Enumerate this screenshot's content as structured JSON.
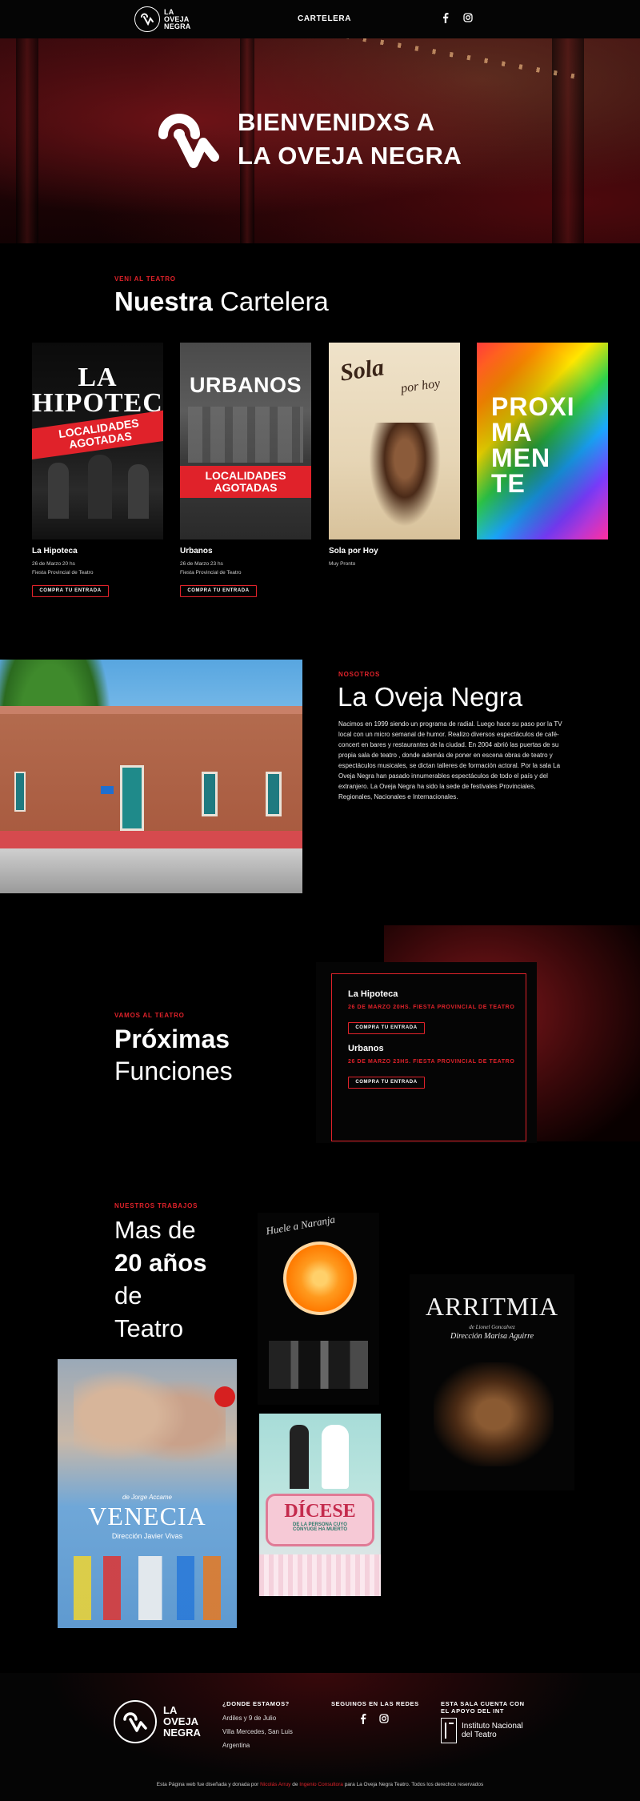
{
  "header": {
    "brand_line1": "LA",
    "brand_line2": "OVEJA",
    "brand_line3": "NEGRA",
    "nav_item": "CARTELERA",
    "social_icons": [
      "facebook-icon",
      "instagram-icon"
    ]
  },
  "hero": {
    "title_line1": "BIENVENIDXS A",
    "title_line2": "LA OVEJA NEGRA"
  },
  "cartelera": {
    "eyebrow": "VENI AL TEATRO",
    "title_bold": "Nuestra",
    "title_light": "Cartelera",
    "cards": [
      {
        "poster_title_line1": "LA",
        "poster_title_line2": "HIPOTECA",
        "badge_line1": "LOCALIDADES",
        "badge_line2": "AGOTADAS",
        "name": "La Hipoteca",
        "date": "26 de Marzo 20 hs",
        "venue": "Fiesta Provincial de Teatro",
        "button": "COMPRA TU ENTRADA"
      },
      {
        "poster_title": "URBANOS",
        "badge_line1": "LOCALIDADES",
        "badge_line2": "AGOTADAS",
        "name": "Urbanos",
        "date": "26 de Marzo 23 hs",
        "venue": "Fiesta Provincial de Teatro",
        "button": "COMPRA TU ENTRADA"
      },
      {
        "poster_title_line1": "Sola",
        "poster_title_line2": "por hoy",
        "name": "Sola por Hoy",
        "info": "Muy Pronto"
      },
      {
        "poster_lines": [
          "PROXI",
          "MA",
          "MEN",
          "TE"
        ]
      }
    ]
  },
  "nosotros": {
    "eyebrow": "NOSOTROS",
    "title": "La Oveja Negra",
    "text": "Nacimos en 1999 siendo un programa de radial. Luego hace su paso por la TV local con un micro semanal de humor. Realizo diversos espectáculos de café-concert en bares y restaurantes de la ciudad. En 2004 abrió las puertas de su propia sala de teatro , donde además de poner en escena obras de teatro y espectáculos musicales, se dictan talleres de formación actoral. Por la sala La Oveja Negra han pasado innumerables espectáculos de todo el país y del extranjero. La Oveja Negra ha sido la sede de festivales Provinciales, Regionales, Nacionales e Internacionales."
  },
  "proximas": {
    "eyebrow": "VAMOS AL TEATRO",
    "title_bold": "Próximas",
    "title_light": "Funciones",
    "functions": [
      {
        "name": "La Hipoteca",
        "date": "26 DE MARZO 20HS. FIESTA PROVINCIAL DE TEATRO",
        "button": "COMPRA TU ENTRADA"
      },
      {
        "name": "Urbanos",
        "date": "26 DE MARZO 23HS. FIESTA PROVINCIAL DE TEATRO",
        "button": "COMPRA TU ENTRADA"
      }
    ]
  },
  "trabajos": {
    "eyebrow": "NUESTROS TRABAJOS",
    "title_line1": "Mas de",
    "title_line2": "20 años",
    "title_line3": "de",
    "title_line4": "Teatro",
    "works": {
      "naranja": "Huele a Naranja",
      "arritmia": "ARRITMIA",
      "arritmia_sub1": "de Lionel Goncalvez",
      "arritmia_sub2": "Dirección Marisa Aguirre",
      "venecia_author": "de Jorge Accame",
      "venecia": "VENECIA",
      "venecia_dir": "Dirección Javier Vivas",
      "dicese_line1": "DÍCESE",
      "dicese_line2": "DE LA PERSONA CUYO",
      "dicese_line3": "CÓNYUGE HA MUERTO"
    }
  },
  "footer": {
    "brand_line1": "LA",
    "brand_line2": "OVEJA",
    "brand_line3": "NEGRA",
    "donde_heading": "¿DONDE ESTAMOS?",
    "address_line1": "Ardiles y 9 de Julio",
    "address_line2": "Villa Mercedes, San Luis",
    "address_line3": "Argentina",
    "redes_heading": "SEGUINOS EN LAS REDES",
    "int_heading_line1": "ESTA SALA CUENTA CON",
    "int_heading_line2": "EL APOYO DEL INT",
    "int_line1": "Instituto Nacional",
    "int_line2": "del Teatro",
    "credits_part1": "Esta Página web fue diseñada y donada por",
    "credits_name1": "Nicolás Arruy",
    "credits_part2": "de",
    "credits_name2": "Ingenio Consultora",
    "credits_part3": "para La Oveja Negra Teatro. Todos los derechos reservados"
  },
  "colors": {
    "accent": "#e0222a",
    "background": "#000000"
  }
}
